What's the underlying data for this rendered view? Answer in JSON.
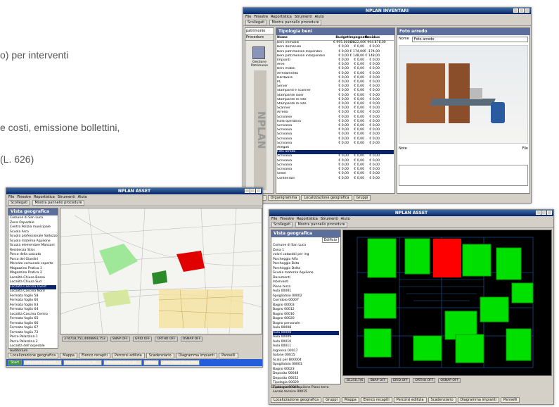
{
  "background_text": [
    "o) per interventi",
    "e costi, emissione bollettini,",
    "(L. 626)"
  ],
  "shot1": {
    "title": "NPLAN INVENTARI",
    "menu": [
      "File",
      "Finestre",
      "Reportistica",
      "Strumenti",
      "Aiuto"
    ],
    "toolbar": [
      "Scollegati",
      "Mostra pannello procedure"
    ],
    "left_tabs": [
      "patrimonio",
      "Procedure"
    ],
    "left_label": "Gestione Patrimonio",
    "panel_title": "Tipologia beni",
    "columns": [
      "Nome",
      "Budget",
      "Impegnato",
      "Residuo"
    ],
    "rows": [
      [
        "Beni immobili",
        "€ 995.000,00",
        "€ 122,00",
        "€ 994.878,00"
      ],
      [
        "Beni demaniali",
        "€ 0,00",
        "€ 0,00",
        "€ 0,00"
      ],
      [
        "Beni patrimoniali disponibili",
        "€ 0,00",
        "€ 174,00",
        "€ -174,00"
      ],
      [
        "Beni patrimoniali indisponibili",
        "€ 0,00",
        "€ 148,00",
        "€ 148,00"
      ],
      [
        "Impianti",
        "€ 0,00",
        "€ 0,00",
        "€ 0,00"
      ],
      [
        "Aree",
        "€ 0,00",
        "€ 0,00",
        "€ 0,00"
      ],
      [
        "Beni mobili",
        "€ 0,00",
        "€ 0,00",
        "€ 0,00"
      ],
      [
        "Arredamento",
        "€ 0,00",
        "€ 0,00",
        "€ 0,00"
      ],
      [
        "Hardware",
        "€ 0,00",
        "€ 0,00",
        "€ 0,00"
      ],
      [
        "PC",
        "€ 0,00",
        "€ 0,00",
        "€ 0,00"
      ],
      [
        "Server",
        "€ 0,00",
        "€ 0,00",
        "€ 0,00"
      ],
      [
        "Stampanti e scanner",
        "€ 0,00",
        "€ 0,00",
        "€ 0,00"
      ],
      [
        "Stampante laser",
        "€ 0,00",
        "€ 0,00",
        "€ 0,00"
      ],
      [
        "Stampante di rete",
        "€ 0,00",
        "€ 0,00",
        "€ 0,00"
      ],
      [
        "Stampante di rete",
        "€ 0,00",
        "€ 0,00",
        "€ 0,00"
      ],
      [
        "Scanner",
        "€ 0,00",
        "€ 0,00",
        "€ 0,00"
      ],
      [
        "Arredo",
        "€ 0,00",
        "€ 0,00",
        "€ 0,00"
      ],
      [
        "Scrivanie",
        "€ 0,00",
        "€ 0,00",
        "€ 0,00"
      ],
      [
        "Isola operativa",
        "€ 0,00",
        "€ 0,00",
        "€ 0,00"
      ],
      [
        "Scrivania",
        "€ 0,00",
        "€ 0,00",
        "€ 0,00"
      ],
      [
        "Scrivania",
        "€ 0,00",
        "€ 0,00",
        "€ 0,00"
      ],
      [
        "Scrivania",
        "€ 0,00",
        "€ 0,00",
        "€ 0,00"
      ],
      [
        "Scrivania",
        "€ 0,00",
        "€ 0,00",
        "€ 0,00"
      ],
      [
        "Scrivania",
        "€ 0,00",
        "€ 0,00",
        "€ 0,00"
      ],
      [
        "Allegati",
        "",
        "",
        ""
      ],
      [
        "Foto arredo",
        "",
        "",
        ""
      ],
      [
        "Scrivania",
        "€ 0,00",
        "€ 0,00",
        "€ 0,00"
      ],
      [
        "Scrivania",
        "€ 0,00",
        "€ 0,00",
        "€ 0,00"
      ],
      [
        "Scrivania",
        "€ 0,00",
        "€ 0,00",
        "€ 0,00"
      ],
      [
        "Scrivania",
        "€ 0,00",
        "€ 0,00",
        "€ 0,00"
      ],
      [
        "Sedie",
        "€ 0,00",
        "€ 0,00",
        "€ 0,00"
      ],
      [
        "Contenitori",
        "€ 0,00",
        "€ 0,00",
        "€ 0,00"
      ]
    ],
    "detail_title": "Foto arredo",
    "detail_field_label": "Nome",
    "detail_field_value": "Foto arredo",
    "note_label": "Note",
    "file_label": "File",
    "tabs": [
      "Tipologie",
      "Organigramma",
      "Localizzazione geografica",
      "Gruppi"
    ]
  },
  "shot2": {
    "title": "NPLAN ASSET",
    "menu": [
      "File",
      "Finestre",
      "Reportistica",
      "Strumenti",
      "Aiuto"
    ],
    "toolbar": [
      "Scollegati",
      "Mostra pannello procedure"
    ],
    "panel_title": "Vista geografica",
    "tree": [
      "Comune di San Luca",
      "Zona Ospedale",
      "Centro Polizia municipale",
      "Scuola Arco",
      "Scuola professionale Salluzzo",
      "Scuola materna Aquilone",
      "Scuola elementare Manzoni",
      "Residenza Stiss",
      "Parco della cascata",
      "Parco dei Giardini",
      "Mercato comunale coperto",
      "Magazzino Pratica 1",
      "Magazzino Pratica 2",
      "Località Chiusa Bassa",
      "Località Chiusa Sud",
      "Località Cascina Ovest",
      "Località Cascina Nord",
      "Fermata foglio 58",
      "Fermata foglio 60",
      "Fermata foglio 63",
      "Fermata foglio 64",
      "Località Cascina Centro",
      "Fermata foglio 65",
      "Fermata foglio 66",
      "Fermata foglio 67",
      "Fermata foglio 72",
      "Parco Palazzina 1",
      "Parco Palazzina 2",
      "Località dell'ospedale",
      "Auditorium",
      "Archivi comunali"
    ],
    "status": [
      "374718,751,4408893,753",
      "SNAP OFF",
      "GRID OFF",
      "ORTHO OFF",
      "OSNAP OFF"
    ],
    "tabs": [
      "Localizzazione geografica",
      "Mappa",
      "Elenco recapiti",
      "Percorsi edilizia",
      "Scadenziario",
      "Diagramma impianti",
      "Pannelli"
    ],
    "taskbar": [
      "Start",
      "Microsoft PowerP...",
      "Presentazione_NI...",
      "Memorandum_pi...",
      "NPlan",
      "Jasc Paint Shop Pro"
    ]
  },
  "shot3": {
    "title": "NPLAN ASSET",
    "menu": [
      "File",
      "Finestre",
      "Reportistica",
      "Strumenti",
      "Aiuto"
    ],
    "toolbar": [
      "Scollegati",
      "Mostra pannello procedure"
    ],
    "panel_title": "Vista geografica",
    "filter": "Edificio",
    "tree": [
      "Comune di San Luca",
      "Zona 1",
      "valori catastali per ing",
      "Parcheggio Alfa",
      "Parcheggio Beta",
      "Parcheggio Delta",
      "Scuola materna Aquilone",
      "Documenti",
      "Interventi",
      "Piano terra",
      "Aula 00001",
      "Spogliatoio 00002",
      "Corridoio 00007",
      "Bagno 00003",
      "Bagno 00012",
      "Bagno 00016",
      "Bagno 00020",
      "Bagno personale",
      "Aula 00008",
      "Aula 00008",
      "Aula 00009",
      "Aula 00010",
      "Aula 00011",
      "Ingresso 00017",
      "Salone 00015",
      "Scala per B00004",
      "Spogliatoio 00001",
      "Bagno 00023",
      "Deposito 00048",
      "Deposito 00022",
      "Tipologia 00029",
      "Tipologia 00040",
      "Locale tecnico 00015"
    ],
    "status": [
      "B1250,7(6",
      "SNAP OFF",
      "GRID OFF",
      "ORTHO OFF",
      "OSNAP OFF"
    ],
    "status_caption": "Scuola materna Aquilone Piano terra",
    "tabs": [
      "Localizzazione geografica",
      "Gruppi",
      "Mappa",
      "Elenco recapiti",
      "Percorsi edilizia",
      "Scadenziario",
      "Diagramma impianti",
      "Pannelli"
    ]
  }
}
